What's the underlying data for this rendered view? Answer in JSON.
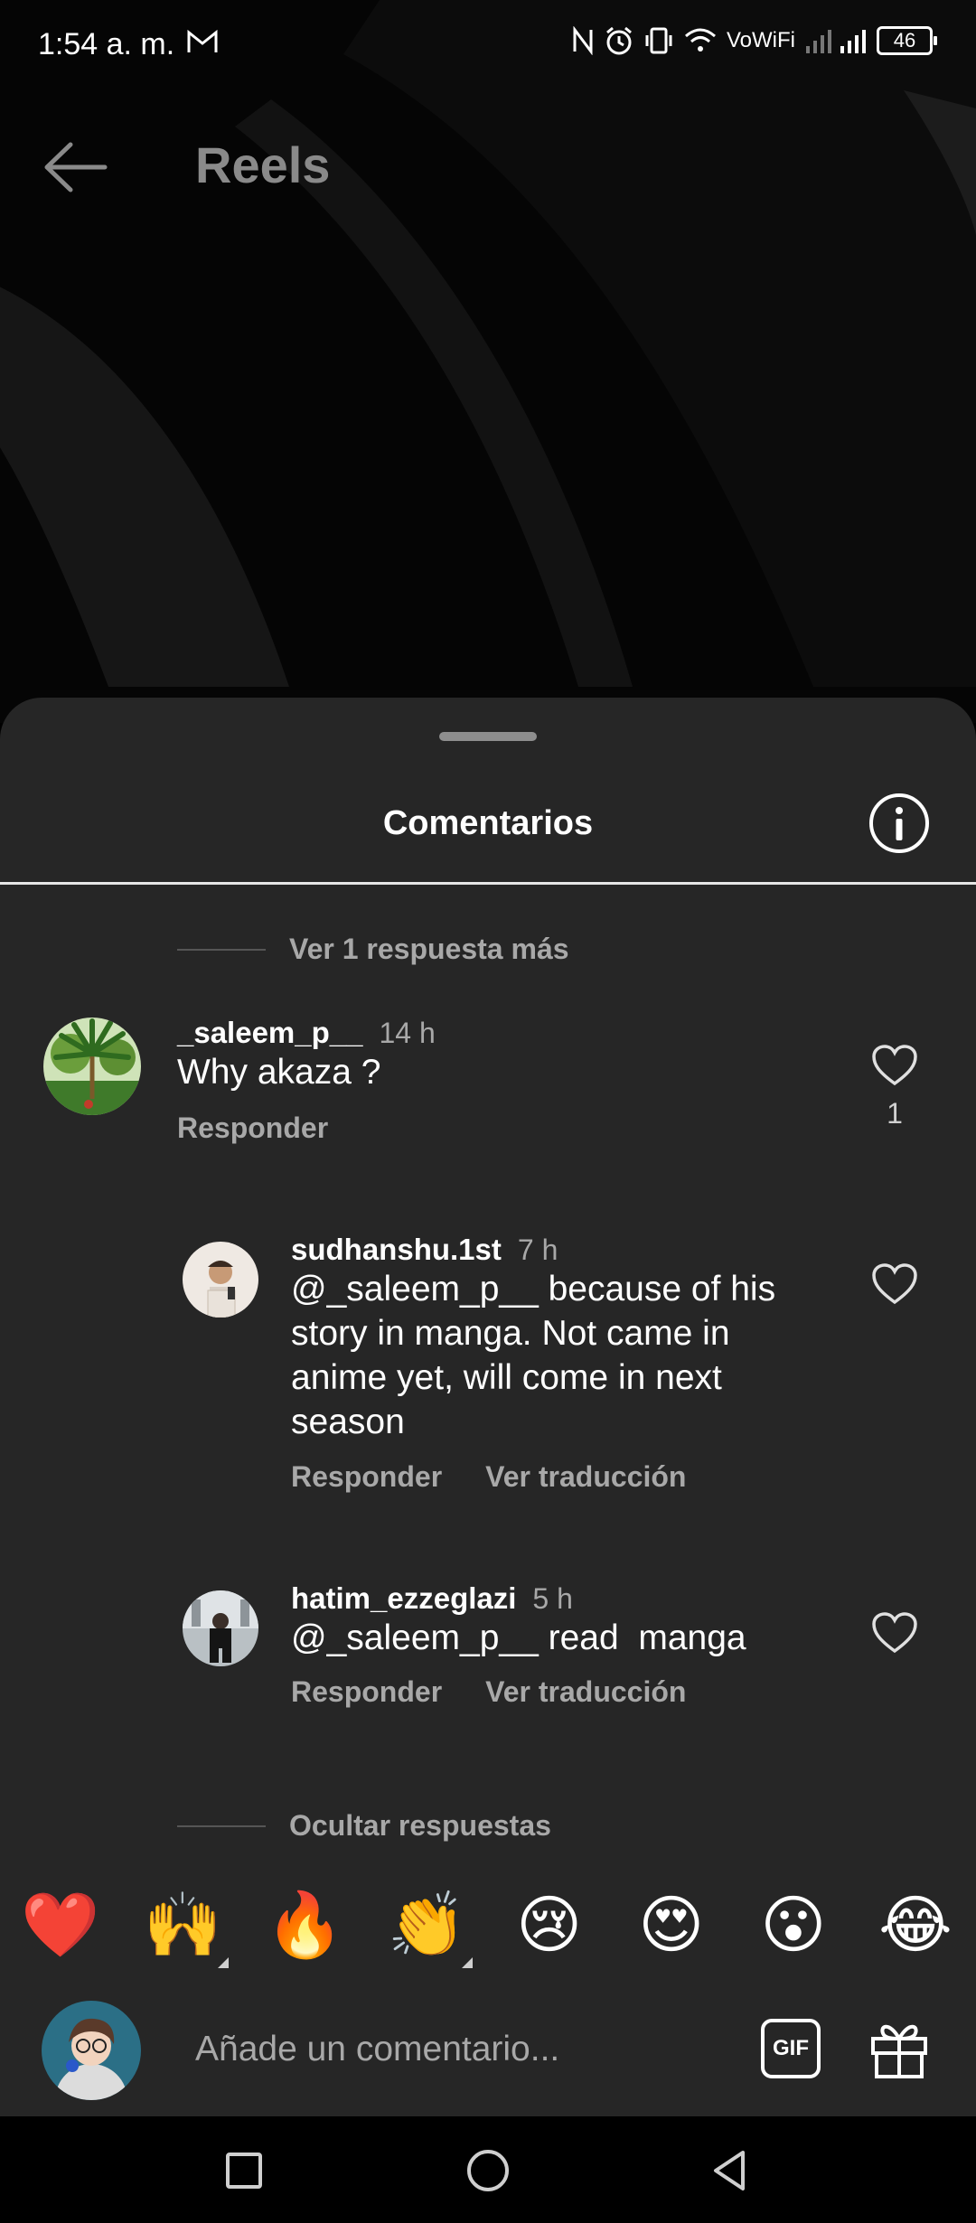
{
  "status_bar": {
    "time": "1:54 a. m.",
    "network_label": "VoWiFi",
    "battery": "46",
    "icons": [
      "gmail-icon",
      "nfc-icon",
      "alarm-icon",
      "vibrate-icon",
      "wifi-icon",
      "signal-icon"
    ]
  },
  "header": {
    "title": "Reels",
    "back_icon": "arrow-left-icon"
  },
  "sheet": {
    "title": "Comentarios",
    "info_icon": "info-icon",
    "view_more_replies": "Ver 1 respuesta más",
    "hide_replies": "Ocultar respuestas"
  },
  "comments": [
    {
      "username": "_saleem_p__",
      "time": "14 h",
      "text": "Why akaza ?",
      "actions": [
        "Responder"
      ],
      "likes": "1"
    },
    {
      "username": "sudhanshu.1st",
      "time": "7 h",
      "text_lines": [
        "@_saleem_p__ because of his",
        "story in manga. Not came in",
        "anime yet, will come in next",
        "season"
      ],
      "actions": [
        "Responder",
        "Ver traducción"
      ]
    },
    {
      "username": "hatim_ezzeglazi",
      "time": "5 h",
      "text": "@_saleem_p__ read  manga",
      "actions": [
        "Responder",
        "Ver traducción"
      ]
    }
  ],
  "emoji_bar": [
    "❤️",
    "🙌",
    "🔥",
    "👏",
    "😢",
    "😍",
    "😮",
    "😂"
  ],
  "composer": {
    "placeholder": "Añade un comentario...",
    "gif_label": "GIF",
    "gift_icon": "gift-icon"
  },
  "colors": {
    "sheet_bg": "#262626",
    "muted_text": "#a8a8a8",
    "background": "#000000"
  }
}
